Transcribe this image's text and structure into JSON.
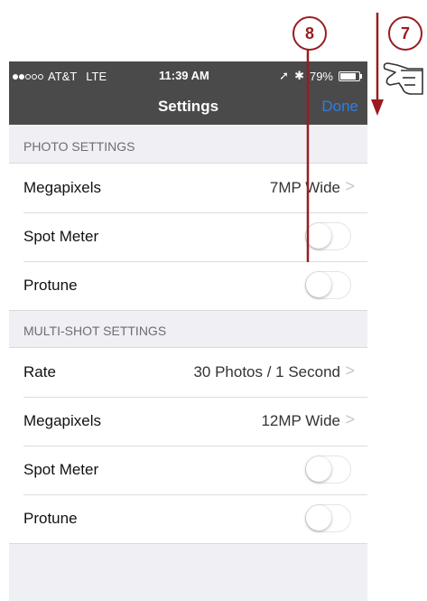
{
  "status_bar": {
    "carrier": "AT&T",
    "network": "LTE",
    "time": "11:39 AM",
    "battery": "79%",
    "signal_bars": 2
  },
  "nav": {
    "title": "Settings",
    "done_label": "Done"
  },
  "sections": [
    {
      "header": "PHOTO SETTINGS",
      "rows": [
        {
          "label": "Megapixels",
          "value": "7MP Wide",
          "type": "disclosure"
        },
        {
          "label": "Spot Meter",
          "type": "toggle",
          "on": false
        },
        {
          "label": "Protune",
          "type": "toggle",
          "on": false
        }
      ]
    },
    {
      "header": "MULTI-SHOT SETTINGS",
      "rows": [
        {
          "label": "Rate",
          "value": "30 Photos / 1 Second",
          "type": "disclosure"
        },
        {
          "label": "Megapixels",
          "value": "12MP Wide",
          "type": "disclosure"
        },
        {
          "label": "Spot Meter",
          "type": "toggle",
          "on": false
        },
        {
          "label": "Protune",
          "type": "toggle",
          "on": false
        }
      ]
    }
  ],
  "callouts": {
    "toggle_callout": "8",
    "scroll_callout": "7"
  },
  "colors": {
    "accent": "#2f7fe0",
    "callout": "#9b1c1f",
    "bar": "#4a4a4a"
  }
}
